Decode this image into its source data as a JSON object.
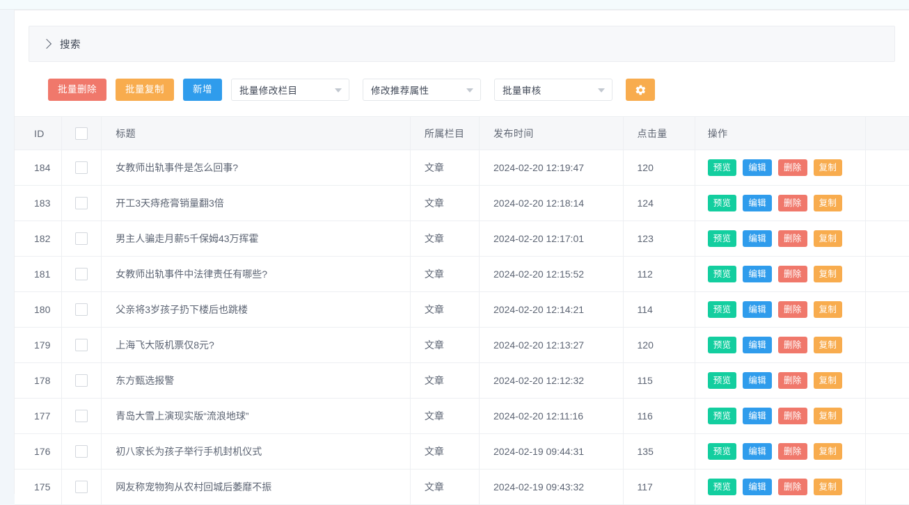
{
  "search_panel": {
    "label": "搜索",
    "expand_icon": "chevron-right-icon"
  },
  "toolbar": {
    "batch_delete_label": "批量删除",
    "batch_copy_label": "批量复制",
    "add_label": "新增",
    "selects": [
      {
        "name": "batch-change-category",
        "value": "批量修改栏目"
      },
      {
        "name": "change-recommend-attribute",
        "value": "修改推荐属性"
      },
      {
        "name": "batch-audit",
        "value": "批量审核"
      }
    ],
    "settings_icon": "gear-icon",
    "colors": {
      "danger": "#f0786b",
      "warn": "#f8ac4e",
      "primary": "#2f9cec",
      "success": "#13ce9f"
    }
  },
  "table": {
    "headers": {
      "id": "ID",
      "select_all": "",
      "title": "标题",
      "category": "所属栏目",
      "publish_time": "发布时间",
      "hits": "点击量",
      "operations": "操作"
    },
    "row_actions": {
      "preview": "预览",
      "edit": "编辑",
      "delete": "删除",
      "copy": "复制"
    },
    "rows": [
      {
        "id": "184",
        "title": "女教师出轨事件是怎么回事?",
        "category": "文章",
        "publish_time": "2024-02-20 12:19:47",
        "hits": "120"
      },
      {
        "id": "183",
        "title": "开工3天痔疮膏销量翻3倍",
        "category": "文章",
        "publish_time": "2024-02-20 12:18:14",
        "hits": "124"
      },
      {
        "id": "182",
        "title": "男主人骗走月薪5千保姆43万挥霍",
        "category": "文章",
        "publish_time": "2024-02-20 12:17:01",
        "hits": "123"
      },
      {
        "id": "181",
        "title": "女教师出轨事件中法律责任有哪些?",
        "category": "文章",
        "publish_time": "2024-02-20 12:15:52",
        "hits": "112"
      },
      {
        "id": "180",
        "title": "父亲将3岁孩子扔下楼后也跳楼",
        "category": "文章",
        "publish_time": "2024-02-20 12:14:21",
        "hits": "114"
      },
      {
        "id": "179",
        "title": "上海飞大阪机票仅8元?",
        "category": "文章",
        "publish_time": "2024-02-20 12:13:27",
        "hits": "120"
      },
      {
        "id": "178",
        "title": "东方甄选报警",
        "category": "文章",
        "publish_time": "2024-02-20 12:12:32",
        "hits": "115"
      },
      {
        "id": "177",
        "title": "青岛大雪上演现实版“流浪地球”",
        "category": "文章",
        "publish_time": "2024-02-20 12:11:16",
        "hits": "116"
      },
      {
        "id": "176",
        "title": "初八家长为孩子举行手机封机仪式",
        "category": "文章",
        "publish_time": "2024-02-19 09:44:31",
        "hits": "135"
      },
      {
        "id": "175",
        "title": "网友称宠物狗从农村回城后萎靡不振",
        "category": "文章",
        "publish_time": "2024-02-19 09:43:32",
        "hits": "117"
      }
    ]
  }
}
